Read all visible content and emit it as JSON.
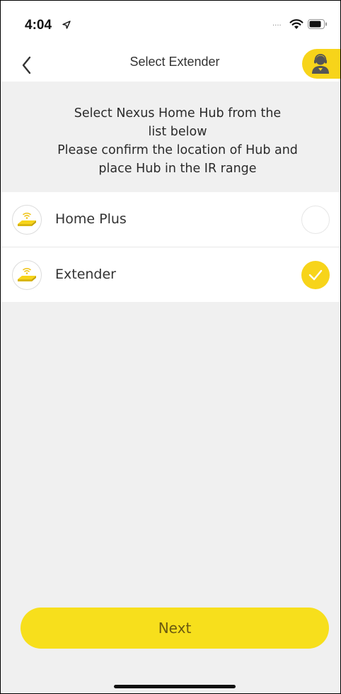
{
  "status_bar": {
    "time": "4:04",
    "signal": "....",
    "icons": [
      "location-arrow-icon",
      "wifi-icon",
      "battery-icon"
    ]
  },
  "nav": {
    "title": "Select Extender",
    "back_icon": "chevron-left-icon",
    "support_icon": "support-agent-icon"
  },
  "instructions": {
    "lines": [
      "Select Nexus Home Hub from the",
      "list below",
      "Please confirm the location of Hub and",
      "place Hub in the IR range"
    ]
  },
  "devices": [
    {
      "label": "Home Plus",
      "icon": "hub-device-icon",
      "selected": false
    },
    {
      "label": "Extender",
      "icon": "hub-device-icon",
      "selected": true
    }
  ],
  "actions": {
    "next_label": "Next"
  },
  "colors": {
    "accent": "#f7d41a",
    "background": "#f0f0f0",
    "next_text": "#6b5a10"
  }
}
